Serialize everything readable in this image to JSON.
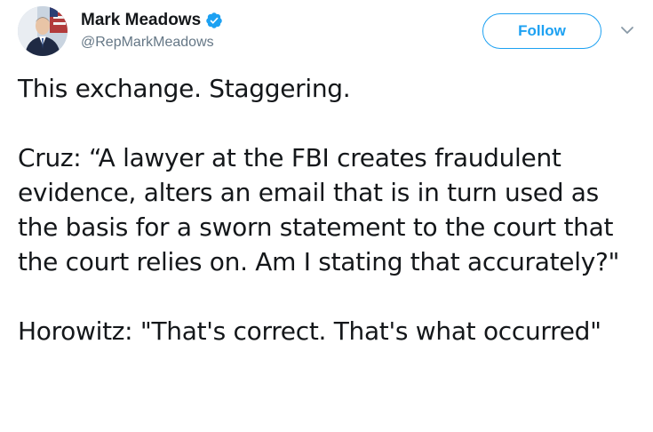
{
  "author": {
    "display_name": "Mark Meadows",
    "handle": "@RepMarkMeadows",
    "verified": true,
    "verified_icon": "verified-badge-icon",
    "verified_color": "#1da1f2"
  },
  "actions": {
    "follow_label": "Follow",
    "more_icon": "chevron-down-icon"
  },
  "tweet": {
    "paragraphs": [
      "This exchange. Staggering.",
      "Cruz: “A lawyer at the FBI creates fraudulent evidence, alters an email that is in turn used as the basis for a sworn statement to the court that the court relies on. Am I stating that accurately?\"",
      "Horowitz: \"That's correct. That's what occurred\""
    ]
  },
  "colors": {
    "accent": "#1da1f2",
    "text": "#14171a",
    "secondary_text": "#657786"
  }
}
